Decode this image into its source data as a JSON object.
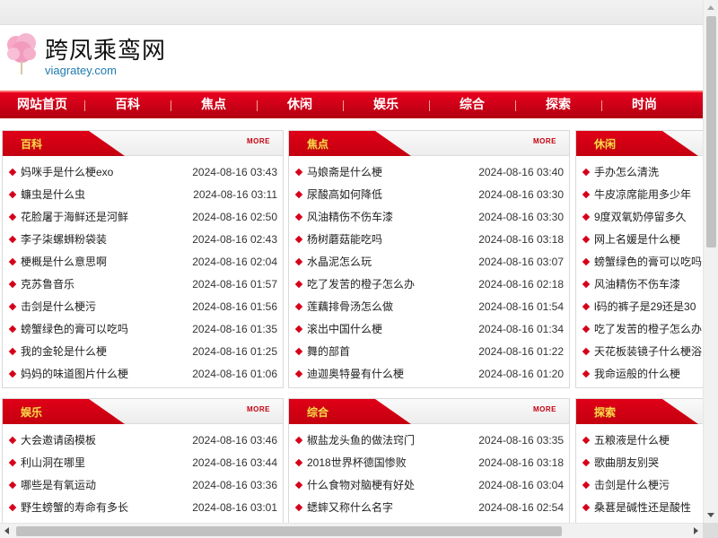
{
  "header": {
    "title": "跨凤乘鸾网",
    "domain": "viagratey.com",
    "logo_icon": "cotton-candy-icon"
  },
  "colors": {
    "brand_red": "#d6001a",
    "link_blue": "#1f7ab0"
  },
  "nav": [
    "网站首页",
    "百科",
    "焦点",
    "休闲",
    "娱乐",
    "综合",
    "探索",
    "时尚"
  ],
  "more_label": "MORE",
  "panels": [
    {
      "title": "百科",
      "items": [
        {
          "title": "妈咪手是什么梗exo",
          "date": "2024-08-16 03:43"
        },
        {
          "title": "蠊虫是什么虫",
          "date": "2024-08-16 03:11"
        },
        {
          "title": "花脸屠于海鲜还是河鲜",
          "date": "2024-08-16 02:50"
        },
        {
          "title": "李子柒螺蛳粉袋装",
          "date": "2024-08-16 02:43"
        },
        {
          "title": "梗概是什么意思啊",
          "date": "2024-08-16 02:04"
        },
        {
          "title": "克苏鲁音乐",
          "date": "2024-08-16 01:57"
        },
        {
          "title": "击剑是什么梗污",
          "date": "2024-08-16 01:56"
        },
        {
          "title": "螃蟹绿色的膏可以吃吗",
          "date": "2024-08-16 01:35"
        },
        {
          "title": "我的金轮是什么梗",
          "date": "2024-08-16 01:25"
        },
        {
          "title": "妈妈的味道图片什么梗",
          "date": "2024-08-16 01:06"
        }
      ]
    },
    {
      "title": "焦点",
      "items": [
        {
          "title": "马娘斋是什么梗",
          "date": "2024-08-16 03:40"
        },
        {
          "title": "尿酸高如何降低",
          "date": "2024-08-16 03:30"
        },
        {
          "title": "风油精伤不伤车漆",
          "date": "2024-08-16 03:30"
        },
        {
          "title": "杨树蘑菇能吃吗",
          "date": "2024-08-16 03:18"
        },
        {
          "title": "水晶泥怎么玩",
          "date": "2024-08-16 03:07"
        },
        {
          "title": "吃了发苦的橙子怎么办",
          "date": "2024-08-16 02:18"
        },
        {
          "title": "莲藕排骨汤怎么做",
          "date": "2024-08-16 01:54"
        },
        {
          "title": "滚出中国什么梗",
          "date": "2024-08-16 01:34"
        },
        {
          "title": "舞的部首",
          "date": "2024-08-16 01:22"
        },
        {
          "title": "迪迦奥特曼有什么梗",
          "date": "2024-08-16 01:20"
        }
      ]
    },
    {
      "title": "休闲",
      "items": [
        {
          "title": "手办怎么清洗",
          "date": ""
        },
        {
          "title": "牛皮凉席能用多少年",
          "date": ""
        },
        {
          "title": "9度双氧奶停留多久",
          "date": ""
        },
        {
          "title": "网上名媛是什么梗",
          "date": ""
        },
        {
          "title": "螃蟹绿色的膏可以吃吗",
          "date": ""
        },
        {
          "title": "风油精伤不伤车漆",
          "date": ""
        },
        {
          "title": "l码的裤子是29还是30",
          "date": ""
        },
        {
          "title": "吃了发苦的橙子怎么办",
          "date": ""
        },
        {
          "title": "天花板装镜子什么梗浴",
          "date": ""
        },
        {
          "title": "我命运般的什么梗",
          "date": ""
        }
      ]
    },
    {
      "title": "娱乐",
      "items": [
        {
          "title": "大会邀请函模板",
          "date": "2024-08-16 03:46"
        },
        {
          "title": "利山洞在哪里",
          "date": "2024-08-16 03:44"
        },
        {
          "title": "哪些是有氧运动",
          "date": "2024-08-16 03:36"
        },
        {
          "title": "野生螃蟹的寿命有多长",
          "date": "2024-08-16 03:01"
        }
      ]
    },
    {
      "title": "综合",
      "items": [
        {
          "title": "椒盐龙头鱼的做法窍门",
          "date": "2024-08-16 03:35"
        },
        {
          "title": "2018世界杯德国惨败",
          "date": "2024-08-16 03:18"
        },
        {
          "title": "什么食物对脑梗有好处",
          "date": "2024-08-16 03:04"
        },
        {
          "title": "蟋蟀又称什么名字",
          "date": "2024-08-16 02:54"
        }
      ]
    },
    {
      "title": "探索",
      "items": [
        {
          "title": "五粮液是什么梗",
          "date": ""
        },
        {
          "title": "歌曲朋友别哭",
          "date": ""
        },
        {
          "title": "击剑是什么梗污",
          "date": ""
        },
        {
          "title": "桑葚是碱性还是酸性",
          "date": ""
        }
      ]
    }
  ]
}
